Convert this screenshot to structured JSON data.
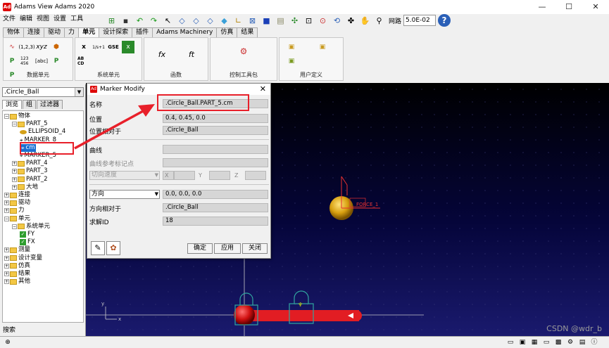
{
  "window": {
    "title": "Adams View Adams 2020",
    "controls": [
      "—",
      "☐",
      "✕"
    ]
  },
  "menu": [
    "文件",
    "编辑",
    "视图",
    "设置",
    "工具"
  ],
  "toolbar": {
    "grid_label": "网路",
    "grid_value": "5.0E-02",
    "help_glyph": "?"
  },
  "ribbon_tabs": [
    "物体",
    "连接",
    "驱动",
    "力",
    "单元",
    "设计探索",
    "插件",
    "Adams Machinery",
    "仿真",
    "结果"
  ],
  "ribbon_active": "单元",
  "ribbon_groups": [
    {
      "label": "数据单元",
      "icons": [
        "(1,2,3)",
        "xyz",
        "P",
        "123 456",
        "[abc]",
        "P",
        "P"
      ]
    },
    {
      "label": "系统单元",
      "icons": [
        "x",
        "1/s+1",
        "GSE",
        "x",
        "AB CD"
      ]
    },
    {
      "label": "函数",
      "icons": [
        "fx",
        "ft"
      ]
    },
    {
      "label": "控制工具包",
      "icons": [
        "⚙"
      ]
    },
    {
      "label": "用户定义",
      "icons": [
        "▣",
        "▣",
        "▣"
      ]
    }
  ],
  "browser": {
    "object_select": ".Circle_Ball",
    "tabs": [
      "浏览",
      "组",
      "过滤器"
    ],
    "search_label": "搜索",
    "tree": [
      {
        "label": "物体",
        "level": 0,
        "icon": "folder",
        "exp": "−"
      },
      {
        "label": "PART_5",
        "level": 1,
        "icon": "folder",
        "exp": "−"
      },
      {
        "label": "ELLIPSOID_4",
        "level": 2,
        "icon": "ellipsoid",
        "exp": ""
      },
      {
        "label": "MARKER_8",
        "level": 2,
        "icon": "marker",
        "exp": ""
      },
      {
        "label": "cm",
        "level": 2,
        "icon": "marker",
        "exp": "",
        "selected": true
      },
      {
        "label": "MARKER_5",
        "level": 2,
        "icon": "marker",
        "exp": ""
      },
      {
        "label": "PART_4",
        "level": 1,
        "icon": "folder",
        "exp": "+"
      },
      {
        "label": "PART_3",
        "level": 1,
        "icon": "folder",
        "exp": "+"
      },
      {
        "label": "PART_2",
        "level": 1,
        "icon": "folder",
        "exp": "+"
      },
      {
        "label": "大地",
        "level": 1,
        "icon": "folder",
        "exp": "+"
      },
      {
        "label": "连接",
        "level": 0,
        "icon": "folder",
        "exp": "+"
      },
      {
        "label": "驱动",
        "level": 0,
        "icon": "folder",
        "exp": "+"
      },
      {
        "label": "力",
        "level": 0,
        "icon": "folder",
        "exp": "+"
      },
      {
        "label": "单元",
        "level": 0,
        "icon": "folder",
        "exp": "−"
      },
      {
        "label": "系统单元",
        "level": 1,
        "icon": "folder",
        "exp": "−"
      },
      {
        "label": "FY",
        "level": 2,
        "icon": "check",
        "exp": ""
      },
      {
        "label": "FX",
        "level": 2,
        "icon": "check",
        "exp": ""
      },
      {
        "label": "测量",
        "level": 0,
        "icon": "folder",
        "exp": "+"
      },
      {
        "label": "设计变量",
        "level": 0,
        "icon": "folder",
        "exp": "+"
      },
      {
        "label": "仿真",
        "level": 0,
        "icon": "folder",
        "exp": "+"
      },
      {
        "label": "结果",
        "level": 0,
        "icon": "folder",
        "exp": "+"
      },
      {
        "label": "其他",
        "level": 0,
        "icon": "folder",
        "exp": "+"
      }
    ]
  },
  "dialog": {
    "title": "Marker Modify",
    "name_label": "名称",
    "name_value": ".Circle_Ball.PART_5.cm",
    "location_label": "位置",
    "location_value": "0.4, 0.45, 0.0",
    "relative_label": "位置相对于",
    "relative_value": ".Circle_Ball",
    "curve_label": "曲线",
    "curve_value": "",
    "curve_ref_label": "曲线参考标记点",
    "curve_ref_value": "",
    "tangent_select": "切向速度",
    "x_label": "X",
    "y_label": "Y",
    "z_label": "Z",
    "orient_select": "方向",
    "orient_value": "0.0, 0.0, 0.0",
    "orient_rel_label": "方向相对于",
    "orient_rel_value": ".Circle_Ball",
    "solver_id_label": "求解ID",
    "solver_id_value": "18",
    "ok": "确定",
    "apply": "应用",
    "close": "关闭"
  },
  "viewport": {
    "marker_text": "FORCE_1"
  },
  "watermark": "CSDN @wdr_b"
}
